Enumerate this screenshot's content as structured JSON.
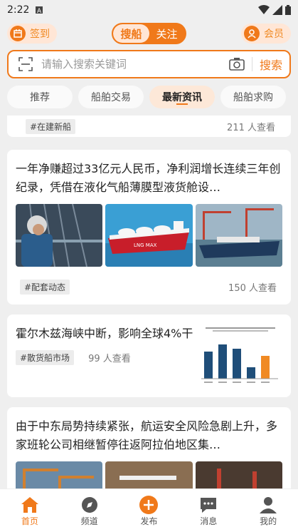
{
  "status": {
    "time": "2:22",
    "sim_icon": "sim-card-icon",
    "wifi_icon": "wifi-icon",
    "signal_icon": "signal-icon",
    "battery_icon": "battery-icon"
  },
  "topbar": {
    "signin_label": "签到",
    "seg_active": "搜船",
    "seg_inactive": "关注",
    "member_label": "会员"
  },
  "search": {
    "placeholder": "请输入搜索关键词",
    "button": "搜索"
  },
  "tabs": [
    {
      "label": "推荐"
    },
    {
      "label": "船舶交易"
    },
    {
      "label": "最新资讯"
    },
    {
      "label": "船舶求购"
    }
  ],
  "feed": {
    "partial_card": {
      "tag": "#在建新船",
      "views": "211 人查看"
    },
    "news1": {
      "title": "一年净赚超过33亿元人民币，净利润增长连续三年创纪录，凭借在液化气船薄膜型液货舱设…",
      "tag": "#配套动态",
      "views": "150 人查看",
      "ship_label": "LNG MAX"
    },
    "news2": {
      "title": "霍尔木兹海峡中断，影响全球4%干",
      "tag": "#散货船市场",
      "views": "99 人查看"
    },
    "news3": {
      "title": "由于中东局势持续紧张，航运安全风险急剧上升，多家班轮公司相继暂停往返阿拉伯地区集…"
    }
  },
  "bottomnav": [
    {
      "label": "首页",
      "icon": "home-icon"
    },
    {
      "label": "频道",
      "icon": "compass-icon"
    },
    {
      "label": "发布",
      "icon": "plus-icon"
    },
    {
      "label": "消息",
      "icon": "message-icon"
    },
    {
      "label": "我的",
      "icon": "user-icon"
    }
  ],
  "colors": {
    "accent": "#f0791a",
    "accent_light": "#ffe6d6"
  }
}
